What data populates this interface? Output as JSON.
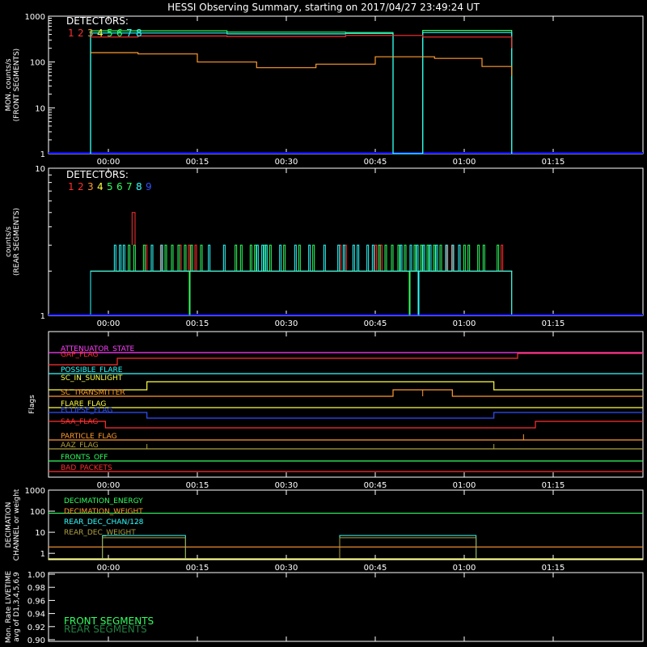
{
  "title": "HESSI Observing Summary, starting on 2017/04/27 23:49:24 UT",
  "x_ticks": [
    "00:00",
    "00:15",
    "00:30",
    "00:45",
    "01:00",
    "01:15"
  ],
  "colors": {
    "det1": "#ff3030",
    "det2": "#ff3030",
    "det3": "#ff9a30",
    "det4": "#ffff40",
    "det5": "#30ff60",
    "det6": "#30ff60",
    "det7": "#30ffff",
    "det8": "#30ffff",
    "det9": "#3050ff",
    "axis": "#ffffff",
    "baseline": "#0000ff"
  },
  "chart_data": [
    {
      "type": "line",
      "panel": "front",
      "ylabel": [
        "MON. counts/s",
        "(FRONT SEGMENTS)"
      ],
      "yscale": "log",
      "ylim": [
        1,
        1000
      ],
      "y_ticks": [
        "1",
        "10",
        "100",
        "1000"
      ],
      "legend_title": "DETECTORS:",
      "legend_digits": [
        "1",
        "2",
        "3",
        "4",
        "5",
        "6",
        "7",
        "8"
      ],
      "xlim_min": [
        0,
        100
      ],
      "series": [
        {
          "color": "#30ff60",
          "points": [
            [
              -3,
              1
            ],
            [
              -3,
              480
            ],
            [
              20,
              450
            ],
            [
              40,
              440
            ],
            [
              48,
              445
            ],
            [
              48,
              1
            ],
            [
              53,
              1
            ],
            [
              53,
              490
            ],
            [
              68,
              490
            ],
            [
              68,
              1
            ]
          ]
        },
        {
          "color": "#30ffff",
          "points": [
            [
              -3,
              1
            ],
            [
              -3,
              430
            ],
            [
              20,
              410
            ],
            [
              40,
              420
            ],
            [
              48,
              420
            ],
            [
              48,
              1
            ],
            [
              53,
              1
            ],
            [
              53,
              440
            ],
            [
              68,
              440
            ],
            [
              68,
              30
            ],
            [
              68,
              1
            ]
          ]
        },
        {
          "color": "#ff3030",
          "points": [
            [
              -3,
              350
            ],
            [
              5,
              370
            ],
            [
              20,
              360
            ],
            [
              40,
              380
            ],
            [
              48,
              380
            ],
            [
              53,
              350
            ],
            [
              68,
              330
            ],
            [
              68,
              200
            ]
          ]
        },
        {
          "color": "#ff9a30",
          "points": [
            [
              -3,
              160
            ],
            [
              5,
              150
            ],
            [
              15,
              100
            ],
            [
              25,
              75
            ],
            [
              35,
              90
            ],
            [
              45,
              130
            ],
            [
              55,
              120
            ],
            [
              63,
              80
            ],
            [
              68,
              50
            ]
          ]
        }
      ]
    },
    {
      "type": "line",
      "panel": "rear",
      "ylabel": [
        "counts/s",
        "(REAR SEGMENTS)"
      ],
      "yscale": "log",
      "ylim": [
        1,
        10
      ],
      "y_ticks": [
        "1",
        "10"
      ],
      "legend_title": "DETECTORS:",
      "legend_digits": [
        "1",
        "2",
        "3",
        "4",
        "5",
        "6",
        "7",
        "8",
        "9"
      ],
      "baseline": 2,
      "peak": 3,
      "burst": 5,
      "series": [
        {
          "color": "#ff3030",
          "ranges": [
            [
              4,
              10
            ],
            [
              12,
              15
            ],
            [
              37,
              42
            ],
            [
              44,
              48
            ],
            [
              55,
              60
            ],
            [
              64,
              68
            ]
          ]
        },
        {
          "color": "#30ff60",
          "ranges": [
            [
              2,
              6
            ],
            [
              9,
              16
            ],
            [
              20,
              35
            ],
            [
              45,
              57
            ],
            [
              59,
              66
            ]
          ]
        },
        {
          "color": "#30ffff",
          "ranges": [
            [
              1,
              4
            ],
            [
              6,
              9
            ],
            [
              14,
              20
            ],
            [
              25,
              45
            ],
            [
              48,
              60
            ]
          ]
        }
      ]
    },
    {
      "type": "table",
      "panel": "flags",
      "ylabel": "Flags",
      "flags": [
        {
          "name": "ATTENUATOR_STATE",
          "color": "#ff40ff"
        },
        {
          "name": "GAP_FLAG",
          "color": "#ff3030"
        },
        {
          "name": "POSSIBLE_FLARE",
          "color": "#30ffff"
        },
        {
          "name": "SC_IN_SUNLIGHT",
          "color": "#ffff40"
        },
        {
          "name": "SC_TRANSMITTER",
          "color": "#ff9a30"
        },
        {
          "name": "FLARE_FLAG",
          "color": "#ffff40"
        },
        {
          "name": "ECLIPSE_FLAG",
          "color": "#3050ff"
        },
        {
          "name": "SAA_FLAG",
          "color": "#ff3030"
        },
        {
          "name": "PARTICLE_FLAG",
          "color": "#ff9a30"
        },
        {
          "name": "AAZ_FLAG",
          "color": "#b0a040"
        },
        {
          "name": "FRONTS_OFF",
          "color": "#30ff60"
        },
        {
          "name": "BAD_PACKETS",
          "color": "#ff3030"
        }
      ]
    },
    {
      "type": "line",
      "panel": "decimation",
      "ylabel": [
        "DECIMATION",
        "CHANNEL or weight"
      ],
      "yscale": "log",
      "ylim": [
        0.5,
        1000
      ],
      "y_ticks": [
        "1",
        "10",
        "100",
        "1000"
      ],
      "series": [
        {
          "name": "DECIMATION_ENERGY",
          "color": "#30ff60",
          "const": 80
        },
        {
          "name": "DECIMATION_WEIGHT",
          "color": "#ff9a30",
          "const": 2
        },
        {
          "name": "REAR_DEC_CHAN/128",
          "color": "#30ffff",
          "ranges": [
            [
              -1,
              13
            ],
            [
              39,
              62
            ]
          ],
          "level": 7
        },
        {
          "name": "REAR_DEC_WEIGHT",
          "color": "#b0a040",
          "ranges": [
            [
              -1,
              13
            ],
            [
              39,
              62
            ]
          ],
          "level": 6
        }
      ]
    },
    {
      "type": "line",
      "panel": "livetime",
      "ylabel": [
        "Mon. Rate LIVETIME",
        "avg of D1,3,4,5,6,9"
      ],
      "ylim": [
        0.9,
        1.0
      ],
      "y_ticks": [
        "0.90",
        "0.92",
        "0.94",
        "0.96",
        "0.98",
        "1.00"
      ],
      "legend": [
        {
          "name": "FRONT SEGMENTS",
          "color": "#30ff60"
        },
        {
          "name": "REAR SEGMENTS",
          "color": "#208040"
        }
      ]
    }
  ]
}
